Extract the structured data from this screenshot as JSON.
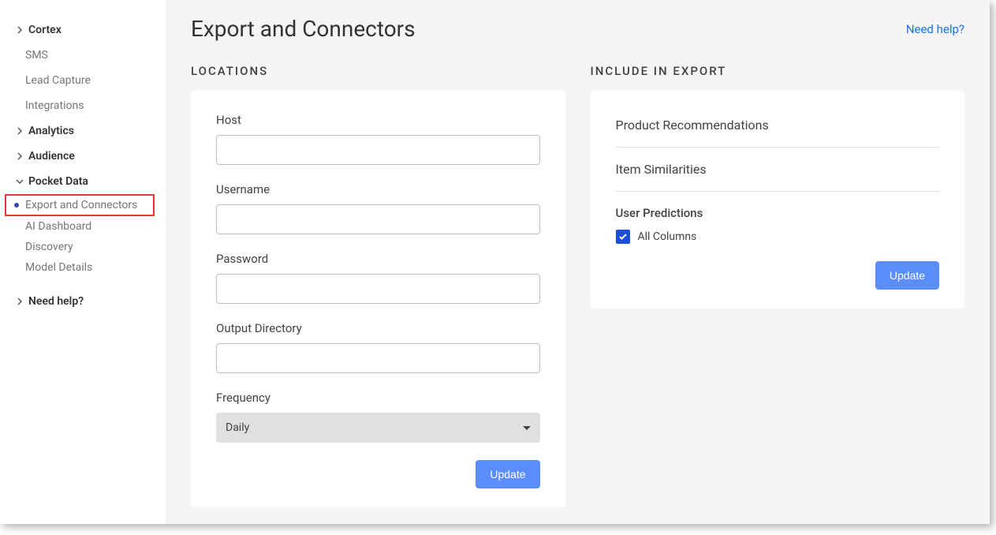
{
  "sidebar": {
    "cortex": {
      "label": "Cortex",
      "items": [
        "SMS",
        "Lead Capture",
        "Integrations"
      ]
    },
    "analytics": {
      "label": "Analytics"
    },
    "audience": {
      "label": "Audience"
    },
    "pocket_data": {
      "label": "Pocket Data",
      "items": [
        "Export and Connectors",
        "AI Dashboard",
        "Discovery",
        "Model Details"
      ]
    },
    "need_help": {
      "label": "Need help?"
    }
  },
  "header": {
    "title": "Export and Connectors",
    "help_link": "Need help?"
  },
  "locations": {
    "title": "LOCATIONS",
    "host_label": "Host",
    "host_value": "",
    "username_label": "Username",
    "username_value": "",
    "password_label": "Password",
    "password_value": "",
    "output_dir_label": "Output Directory",
    "output_dir_value": "",
    "frequency_label": "Frequency",
    "frequency_value": "Daily",
    "update_button": "Update"
  },
  "include": {
    "title": "INCLUDE IN EXPORT",
    "items": [
      "Product Recommendations",
      "Item Similarities"
    ],
    "user_predictions_label": "User Predictions",
    "all_columns_label": "All Columns",
    "all_columns_checked": true,
    "update_button": "Update"
  }
}
